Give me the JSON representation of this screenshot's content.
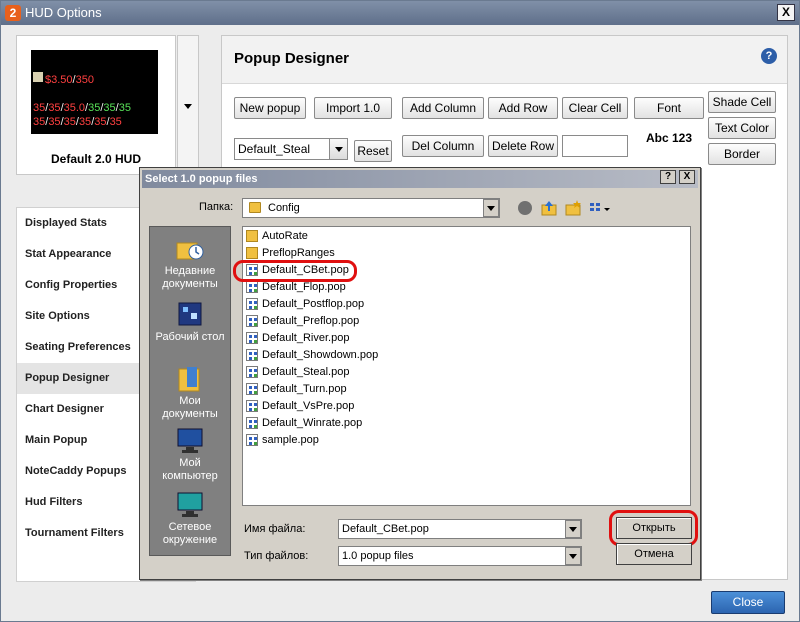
{
  "window": {
    "app_icon_text": "2",
    "title": "HUD Options",
    "close_label": "X"
  },
  "hud_preview": {
    "name": "Default 2.0 HUD",
    "row1": [
      "$3.50",
      "/",
      "350"
    ],
    "row2": [
      "35",
      "/",
      "35",
      "/",
      "35.0",
      "/",
      "35",
      "/",
      "35",
      "/",
      "35"
    ],
    "row3": [
      "35",
      "/",
      "35",
      "/",
      "35",
      "/",
      "35",
      "/",
      "35",
      "/",
      "35"
    ]
  },
  "nav": {
    "items": [
      "Displayed Stats",
      "Stat Appearance",
      "Config Properties",
      "Site Options",
      "Seating Preferences",
      "Popup Designer",
      "Chart Designer",
      "Main Popup",
      "NoteCaddy Popups",
      "Hud Filters",
      "Tournament Filters"
    ],
    "active": "Popup Designer"
  },
  "designer": {
    "title": "Popup Designer",
    "help_label": "?",
    "buttons": {
      "new_popup": "New popup",
      "import": "Import 1.0",
      "add_column": "Add Column",
      "add_row": "Add Row",
      "clear_cell": "Clear Cell",
      "font": "Font",
      "shade_cell": "Shade Cell",
      "text_color": "Text Color",
      "border": "Border",
      "reset": "Reset",
      "del_column": "Del Column",
      "delete_row": "Delete Row"
    },
    "popup_select": "Default_Steal",
    "sample_text": "Abc 123"
  },
  "close_button": "Close",
  "dialog": {
    "title": "Select 1.0 popup files",
    "help_btn": "?",
    "close_btn": "X",
    "folder_label": "Папка:",
    "folder_value": "Config",
    "places": [
      "Недавние документы",
      "Рабочий стол",
      "Мои документы",
      "Мой компьютер",
      "Сетевое окружение"
    ],
    "files": [
      {
        "name": "AutoRate",
        "kind": "folder"
      },
      {
        "name": "PreflopRanges",
        "kind": "folder"
      },
      {
        "name": "Default_CBet.pop",
        "kind": "file"
      },
      {
        "name": "Default_Flop.pop",
        "kind": "file"
      },
      {
        "name": "Default_Postflop.pop",
        "kind": "file"
      },
      {
        "name": "Default_Preflop.pop",
        "kind": "file"
      },
      {
        "name": "Default_River.pop",
        "kind": "file"
      },
      {
        "name": "Default_Showdown.pop",
        "kind": "file"
      },
      {
        "name": "Default_Steal.pop",
        "kind": "file"
      },
      {
        "name": "Default_Turn.pop",
        "kind": "file"
      },
      {
        "name": "Default_VsPre.pop",
        "kind": "file"
      },
      {
        "name": "Default_Winrate.pop",
        "kind": "file"
      },
      {
        "name": "sample.pop",
        "kind": "file"
      }
    ],
    "filename_label": "Имя файла:",
    "filename_value": "Default_CBet.pop",
    "filetype_label": "Тип файлов:",
    "filetype_value": "1.0 popup files",
    "open_button": "Открыть",
    "cancel_button": "Отмена"
  }
}
